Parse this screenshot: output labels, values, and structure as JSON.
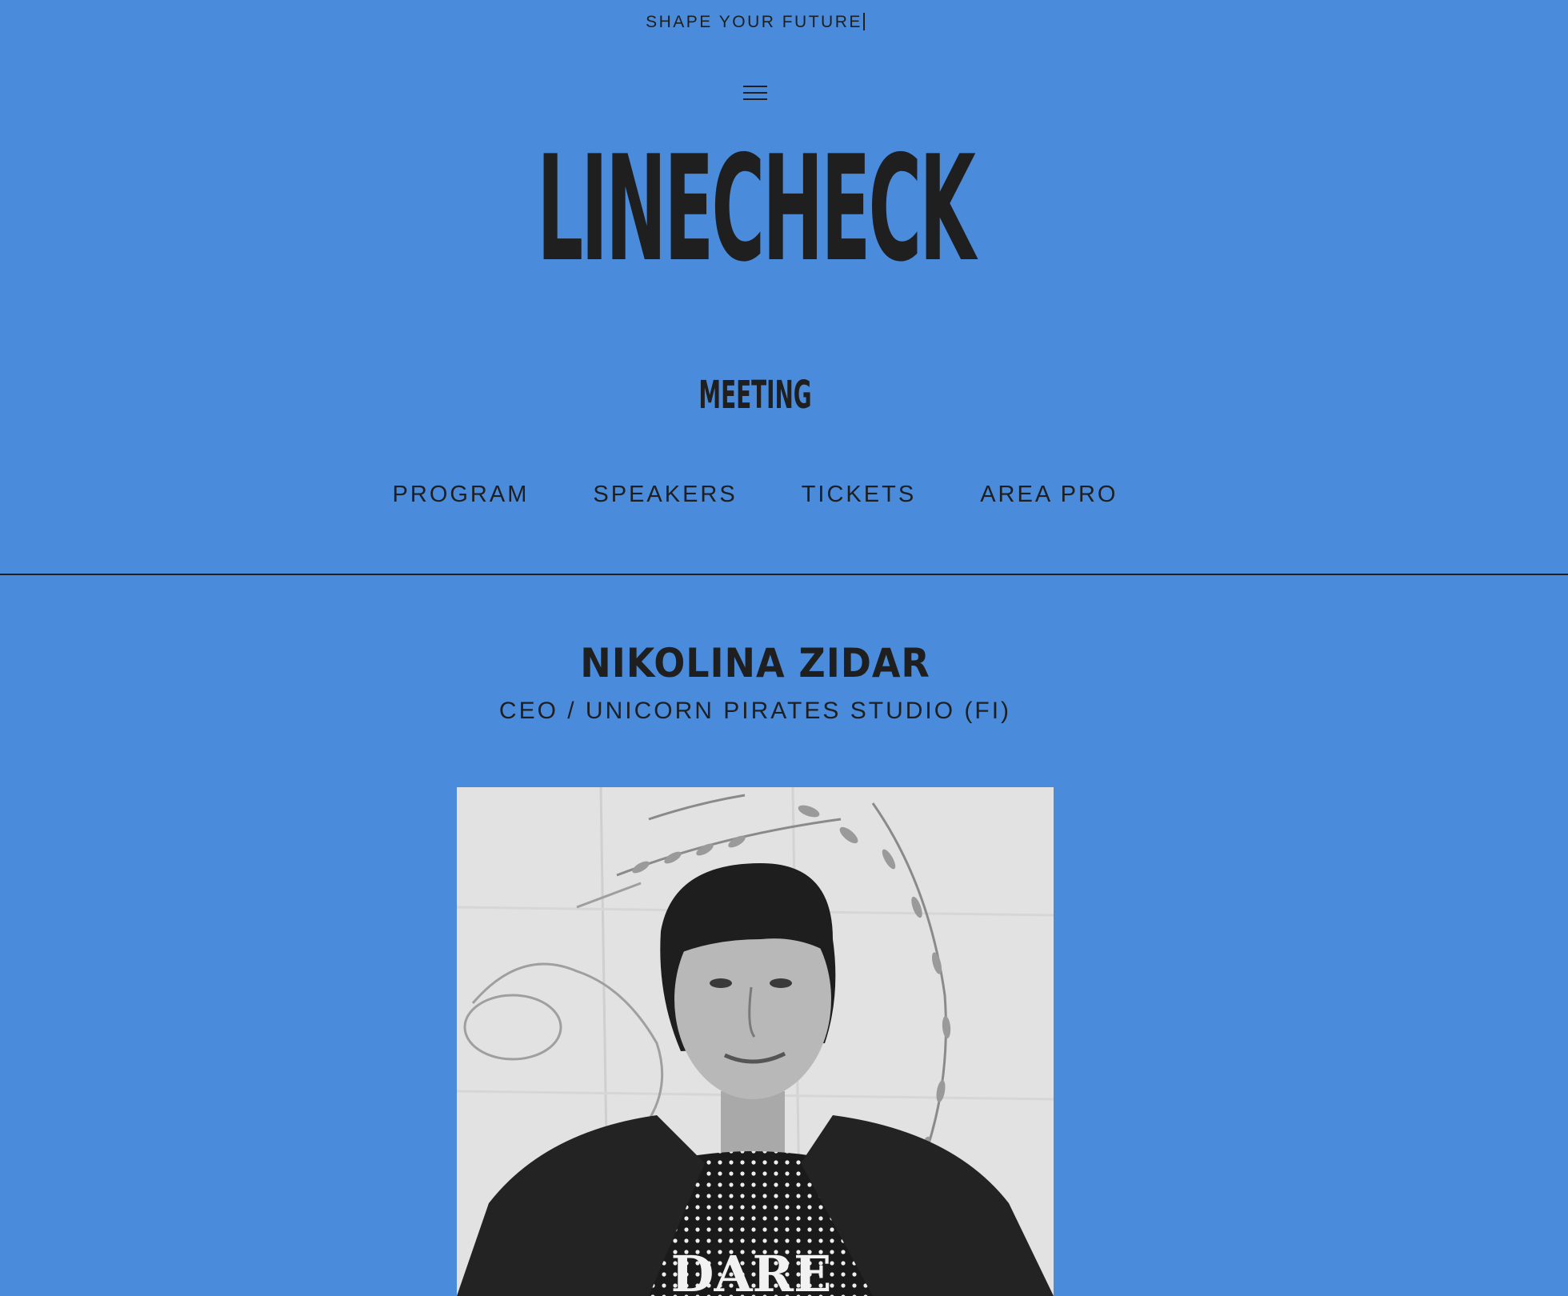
{
  "header": {
    "tagline": "SHAPE YOUR FUTURE",
    "logo": "LINECHECK",
    "subtitle": "MEETING"
  },
  "nav": {
    "items": [
      {
        "label": "PROGRAM"
      },
      {
        "label": "SPEAKERS"
      },
      {
        "label": "TICKETS"
      },
      {
        "label": "AREA PRO"
      }
    ]
  },
  "speaker": {
    "name": "NIKOLINA ZIDAR",
    "role": "CEO / UNICORN PIRATES STUDIO (FI)",
    "photo_shirt_text": "DARE"
  },
  "colors": {
    "background": "#4a8bdb",
    "text": "#1f1f1f"
  },
  "icons": {
    "menu": "hamburger-menu-icon"
  }
}
